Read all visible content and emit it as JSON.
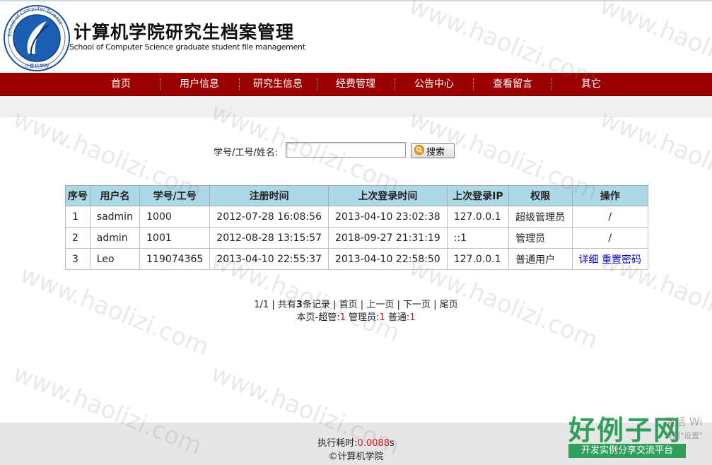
{
  "header": {
    "logo_text": "School of Computer Science",
    "logo_bottom_text": "计算机学院",
    "title_cn": "计算机学院研究生档案管理",
    "title_en": "School of Computer Science graduate student file management"
  },
  "nav": {
    "items": [
      {
        "label": "首页"
      },
      {
        "label": "用户信息"
      },
      {
        "label": "研究生信息"
      },
      {
        "label": "经费管理"
      },
      {
        "label": "公告中心"
      },
      {
        "label": "查看留言"
      },
      {
        "label": "其它"
      }
    ]
  },
  "search": {
    "label": "学号/工号/姓名:",
    "value": "",
    "placeholder": "",
    "button_label": "搜索",
    "button_icon": "search-icon"
  },
  "table": {
    "headers": [
      "序号",
      "用户名",
      "学号/工号",
      "注册时间",
      "上次登录时间",
      "上次登录IP",
      "权限",
      "操作"
    ],
    "rows": [
      {
        "no": "1",
        "username": "sadmin",
        "id": "1000",
        "registered": "2012-07-28 16:08:56",
        "last_login": "2013-04-10 23:02:38",
        "ip": "127.0.0.1",
        "role": "超级管理员",
        "op": "/"
      },
      {
        "no": "2",
        "username": "admin",
        "id": "1001",
        "registered": "2012-08-28 13:15:57",
        "last_login": "2018-09-27 21:31:19",
        "ip": "::1",
        "role": "管理员",
        "op": "/"
      },
      {
        "no": "3",
        "username": "Leo",
        "id": "119074365",
        "registered": "2013-04-10 22:55:37",
        "last_login": "2013-04-10 22:58:50",
        "ip": "127.0.0.1",
        "role": "普通用户",
        "op_links": [
          "详细",
          "重置密码"
        ]
      }
    ]
  },
  "pager": {
    "page": "1/1",
    "total_prefix": "共有",
    "total_count": "3",
    "total_suffix": "条记录",
    "first": "首页",
    "prev": "上一页",
    "next": "下一页",
    "last": "尾页",
    "summary_prefix": "本页-超管:",
    "super_count": "1",
    "admin_label": "管理员:",
    "admin_count": "1",
    "normal_label": "普通:",
    "normal_count": "1"
  },
  "footer": {
    "exec_label": "执行耗时:",
    "exec_value": "0.0088",
    "exec_unit": "s",
    "copyright": "©计算机学院"
  },
  "watermark": {
    "text": "www.haolizi.com",
    "brand": "好例子网",
    "brand_sub": "开发实例分享交流平台",
    "activation": "激活 Wi",
    "activation_sub": "转到\"设置\""
  },
  "colors": {
    "nav_bg": "#9b0000",
    "table_header_bg": "#add8e6",
    "accent_red": "#e0141e",
    "link_blue": "#0000cc",
    "brand_green": "#2f9f5a"
  }
}
